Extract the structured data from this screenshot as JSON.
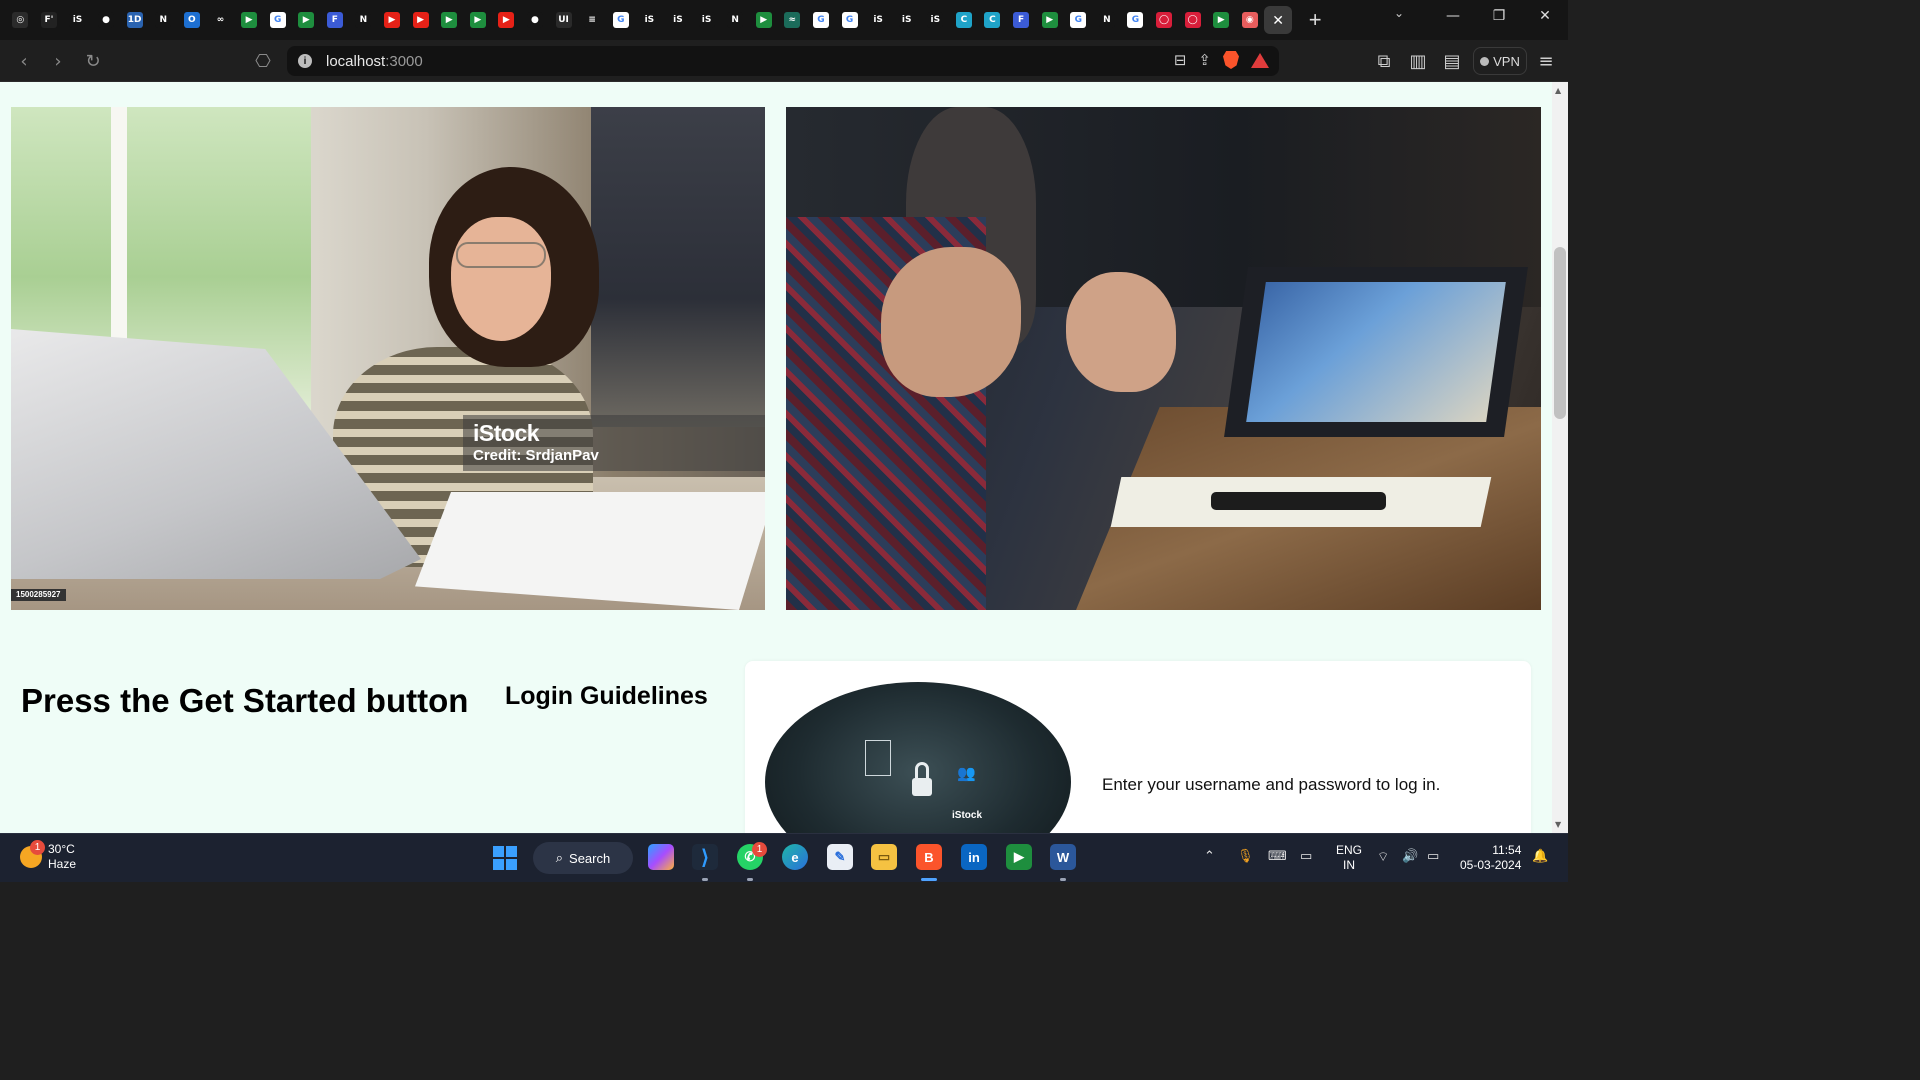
{
  "browser": {
    "tabs": [
      {
        "icon": "chatgpt-icon",
        "color": "#2b2b2b",
        "glyph": "◎"
      },
      {
        "icon": "fiverr-icon",
        "color": "#222",
        "glyph": "F'"
      },
      {
        "icon": "istock-icon",
        "color": "#151515",
        "glyph": "iS"
      },
      {
        "icon": "github-icon",
        "color": "#151515",
        "glyph": "●"
      },
      {
        "icon": "web-icon",
        "color": "#2a63b0",
        "glyph": "1D"
      },
      {
        "icon": "notion-icon",
        "color": "#151515",
        "glyph": "N"
      },
      {
        "icon": "outlook-icon",
        "color": "#1d6fd1",
        "glyph": "O"
      },
      {
        "icon": "codesandbox-icon",
        "color": "#151515",
        "glyph": "∞"
      },
      {
        "icon": "meet-icon",
        "color": "#1e8e3e",
        "glyph": "▶"
      },
      {
        "icon": "google-icon",
        "color": "#ffffff",
        "glyph": "G"
      },
      {
        "icon": "meet-icon",
        "color": "#1e8e3e",
        "glyph": "▶"
      },
      {
        "icon": "forms-icon",
        "color": "#3b5bd6",
        "glyph": "F"
      },
      {
        "icon": "notion-icon",
        "color": "#151515",
        "glyph": "N"
      },
      {
        "icon": "youtube-icon",
        "color": "#e62117",
        "glyph": "▶"
      },
      {
        "icon": "youtube-icon",
        "color": "#e62117",
        "glyph": "▶"
      },
      {
        "icon": "meet-icon",
        "color": "#1e8e3e",
        "glyph": "▶"
      },
      {
        "icon": "meet-icon",
        "color": "#1e8e3e",
        "glyph": "▶"
      },
      {
        "icon": "youtube-icon",
        "color": "#e62117",
        "glyph": "▶"
      },
      {
        "icon": "github-icon",
        "color": "#151515",
        "glyph": "●"
      },
      {
        "icon": "ui-icon",
        "color": "#2a2a2a",
        "glyph": "UI"
      },
      {
        "icon": "stackoverflow-icon",
        "color": "#151515",
        "glyph": "≡"
      },
      {
        "icon": "google-icon",
        "color": "#ffffff",
        "glyph": "G"
      },
      {
        "icon": "istock-icon",
        "color": "#151515",
        "glyph": "iS"
      },
      {
        "icon": "istock-icon",
        "color": "#151515",
        "glyph": "iS"
      },
      {
        "icon": "istock-icon",
        "color": "#151515",
        "glyph": "iS"
      },
      {
        "icon": "notion-icon",
        "color": "#151515",
        "glyph": "N"
      },
      {
        "icon": "meet-icon",
        "color": "#1e8e3e",
        "glyph": "▶"
      },
      {
        "icon": "web-icon",
        "color": "#1b6b5a",
        "glyph": "≈"
      },
      {
        "icon": "google-icon",
        "color": "#ffffff",
        "glyph": "G"
      },
      {
        "icon": "google-icon",
        "color": "#ffffff",
        "glyph": "G"
      },
      {
        "icon": "istock-icon",
        "color": "#151515",
        "glyph": "iS"
      },
      {
        "icon": "istock-icon",
        "color": "#151515",
        "glyph": "iS"
      },
      {
        "icon": "istock-icon",
        "color": "#151515",
        "glyph": "iS"
      },
      {
        "icon": "canva-icon",
        "color": "#1fa3c8",
        "glyph": "C"
      },
      {
        "icon": "canva-icon",
        "color": "#1fa3c8",
        "glyph": "C"
      },
      {
        "icon": "forms-icon",
        "color": "#3b5bd6",
        "glyph": "F"
      },
      {
        "icon": "meet-icon",
        "color": "#1e8e3e",
        "glyph": "▶"
      },
      {
        "icon": "google-icon",
        "color": "#ffffff",
        "glyph": "G"
      },
      {
        "icon": "notion-icon",
        "color": "#151515",
        "glyph": "N"
      },
      {
        "icon": "google-icon",
        "color": "#ffffff",
        "glyph": "G"
      },
      {
        "icon": "opera-icon",
        "color": "#d81e3a",
        "glyph": "◯"
      },
      {
        "icon": "opera-icon",
        "color": "#d81e3a",
        "glyph": "◯"
      },
      {
        "icon": "meet-icon",
        "color": "#1e8e3e",
        "glyph": "▶"
      },
      {
        "icon": "record-icon",
        "color": "#e85d5d",
        "glyph": "◉"
      }
    ],
    "active_tab_close": "✕",
    "new_tab": "+",
    "url_host": "localhost",
    "url_port": ":3000",
    "vpn_label": "VPN"
  },
  "page": {
    "image1_watermark": "iStock",
    "image1_credit": "Credit: SrdjanPav",
    "image1_id": "1500285927",
    "heading": "Press the Get Started button",
    "guidelines_title": "Login Guidelines",
    "card_image_watermark": "iStock",
    "card_text": "Enter your username and password to log in."
  },
  "taskbar": {
    "weather_temp": "30°C",
    "weather_desc": "Haze",
    "weather_badge": "1",
    "search_label": "Search",
    "whatsapp_badge": "1",
    "lang_line1": "ENG",
    "lang_line2": "IN",
    "time": "11:54",
    "date": "05-03-2024"
  },
  "colors": {
    "page_background": "#effdf7",
    "card_background": "#ffffff",
    "browser_chrome": "#1f1f1f",
    "taskbar": "#1c2230"
  }
}
